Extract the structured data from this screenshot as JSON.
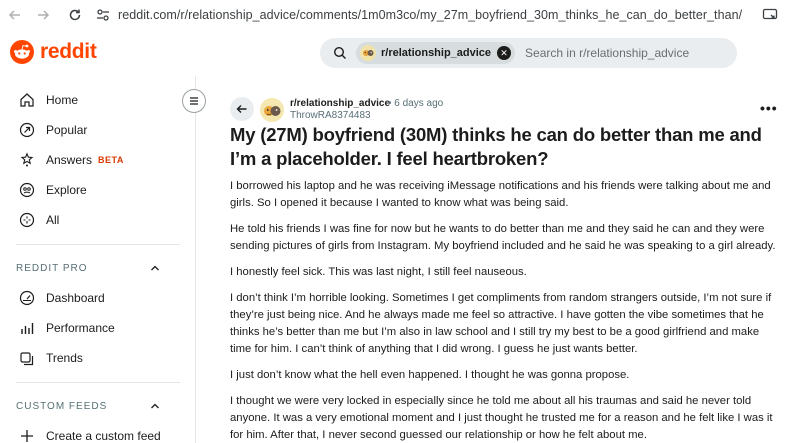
{
  "browser": {
    "url": "reddit.com/r/relationship_advice/comments/1m0m3co/my_27m_boyfriend_30m_thinks_he_can_do_better_than/"
  },
  "header": {
    "logo_text": "reddit",
    "search": {
      "chip_label": "r/relationship_advice",
      "placeholder": "Search in r/relationship_advice"
    }
  },
  "sidebar": {
    "items": [
      {
        "label": "Home",
        "icon": "home-icon"
      },
      {
        "label": "Popular",
        "icon": "popular-icon"
      },
      {
        "label": "Answers",
        "badge": "BETA",
        "icon": "answers-icon"
      },
      {
        "label": "Explore",
        "icon": "explore-icon"
      },
      {
        "label": "All",
        "icon": "all-icon"
      }
    ],
    "pro_section": {
      "title": "REDDIT PRO",
      "items": [
        {
          "label": "Dashboard",
          "icon": "dashboard-icon"
        },
        {
          "label": "Performance",
          "icon": "performance-icon"
        },
        {
          "label": "Trends",
          "icon": "trends-icon"
        }
      ]
    },
    "feeds_section": {
      "title": "CUSTOM FEEDS",
      "items": [
        {
          "label": "Create a custom feed",
          "icon": "plus-icon"
        }
      ]
    }
  },
  "post": {
    "subreddit": "r/relationship_advice",
    "time": "• 6 days ago",
    "author": "ThrowRA8374483",
    "title": "My (27M) boyfriend (30M) thinks he can do better than me and I’m a placeholder. I feel heartbroken?",
    "paragraphs": [
      "I borrowed his laptop and he was receiving iMessage notifications and his friends were talking about me and girls. So I opened it because I wanted to know what was being said.",
      "He told his friends I was fine for now but he wants to do better than me and they said he can and they were sending pictures of girls from Instagram. My boyfriend included and he said he was speaking to a girl already.",
      "I honestly feel sick. This was last night, I still feel nauseous.",
      "I don’t think I’m horrible looking. Sometimes I get compliments from random strangers outside, I’m not sure if they’re just being nice. And he always made me feel so attractive. I have gotten the vibe sometimes that he thinks he’s better than me but I’m also in law school and I still try my best to be a good girlfriend and make time for him. I can’t think of anything that I did wrong. I guess he just wants better.",
      "I just don’t know what the hell even happened. I thought he was gonna propose.",
      "I thought we were very locked in especially since he told me about all his traumas and said he never told anyone. It was a very emotional moment and I just thought he trusted me for a reason and he felt like I was it for him. After that, I never second guessed our relationship or how he felt about me."
    ]
  },
  "colors": {
    "brand": "#ff4500",
    "beta": "#d93900",
    "search_bg": "#eaedef"
  }
}
